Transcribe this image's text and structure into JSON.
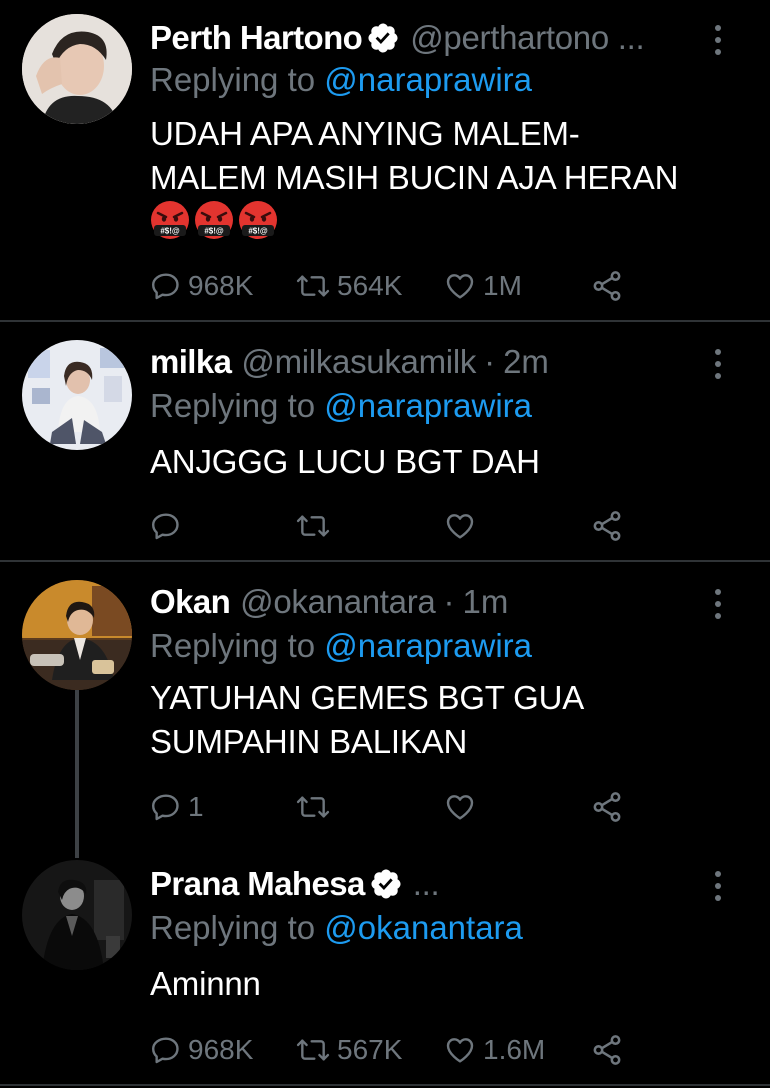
{
  "colors": {
    "background": "#000000",
    "text": "#ffffff",
    "muted": "#6e767d",
    "mention": "#1d9bf0",
    "divider": "#2f3336",
    "verified": "#ffffff"
  },
  "tweets": [
    {
      "name": "Perth Hartono",
      "verified": true,
      "handle": "@perthartono ...",
      "dot": "",
      "time": "",
      "reply_prefix": "Replying to ",
      "reply_to": "@naraprawira",
      "body_lines": [
        "UDAH APA ANYING MALEM-",
        "MALEM MASIH BUCIN AJA HERAN"
      ],
      "emojis": [
        "angry-cursing-face-emoji",
        "angry-cursing-face-emoji",
        "angry-cursing-face-emoji"
      ],
      "emoji_text": "#$!@",
      "reply_count": "968K",
      "retweet_count": "564K",
      "like_count": "1M"
    },
    {
      "name": "milka",
      "verified": false,
      "handle": "@milkasukamilk",
      "dot": "·",
      "time": "2m",
      "reply_prefix": "Replying to ",
      "reply_to": "@naraprawira",
      "body_lines": [
        "ANJGGG LUCU BGT DAH"
      ],
      "reply_count": "",
      "retweet_count": "",
      "like_count": ""
    },
    {
      "name": "Okan",
      "verified": false,
      "handle": "@okanantara",
      "dot": "·",
      "time": "1m",
      "reply_prefix": "Replying to ",
      "reply_to": "@naraprawira",
      "body_lines": [
        "YATUHAN GEMES BGT GUA",
        "SUMPAHIN BALIKAN"
      ],
      "reply_count": "1",
      "retweet_count": "",
      "like_count": ""
    },
    {
      "name": "Prana Mahesa",
      "verified": true,
      "handle": "...",
      "dot": "",
      "time": "",
      "reply_prefix": "Replying to ",
      "reply_to": "@okanantara",
      "body_lines": [
        "Aminnn"
      ],
      "reply_count": "968K",
      "retweet_count": "567K",
      "like_count": "1.6M"
    }
  ]
}
